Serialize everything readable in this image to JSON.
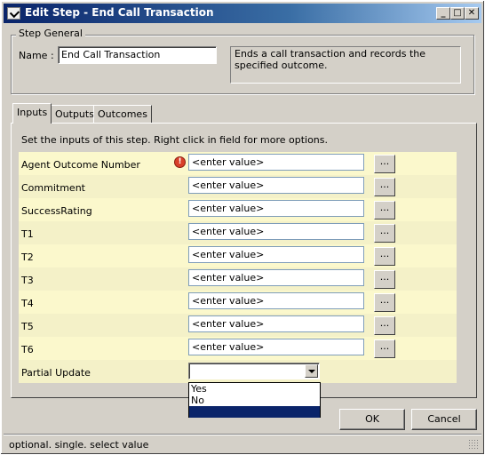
{
  "window": {
    "title": "Edit Step - End Call Transaction",
    "minimize_label": "_",
    "maximize_label": "□",
    "close_label": "✕"
  },
  "step_general": {
    "legend": "Step General",
    "name_label": "Name :",
    "name_value": "End Call Transaction",
    "description": "Ends a call transaction and records the specified outcome."
  },
  "tabs": [
    {
      "label": "Inputs",
      "active": true
    },
    {
      "label": "Outputs",
      "active": false
    },
    {
      "label": "Outcomes",
      "active": false
    }
  ],
  "inputs_panel": {
    "instructions": "Set the inputs of this step.  Right click in field for more options.",
    "ellipsis_label": "...",
    "rows": [
      {
        "label": "Agent Outcome Number",
        "value": "<enter value>",
        "error_icon": "!"
      },
      {
        "label": "Commitment",
        "value": "<enter value>"
      },
      {
        "label": "SuccessRating",
        "value": "<enter value>"
      },
      {
        "label": "T1",
        "value": "<enter value>"
      },
      {
        "label": "T2",
        "value": "<enter value>"
      },
      {
        "label": "T3",
        "value": "<enter value>"
      },
      {
        "label": "T4",
        "value": "<enter value>"
      },
      {
        "label": "T5",
        "value": "<enter value>"
      },
      {
        "label": "T6",
        "value": "<enter value>"
      }
    ],
    "partial_update": {
      "label": "Partial Update",
      "selected": "",
      "options": [
        "Yes",
        "No",
        ""
      ]
    }
  },
  "buttons": {
    "ok": "OK",
    "cancel": "Cancel"
  },
  "status_bar": {
    "text": "optional. single. select value"
  }
}
